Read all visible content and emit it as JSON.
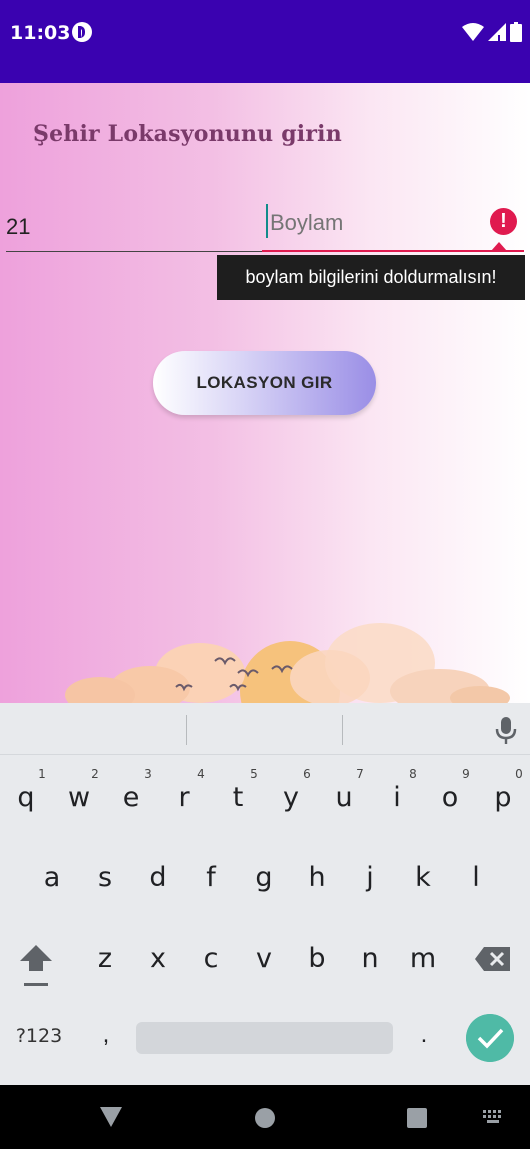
{
  "status_bar": {
    "time": "11:03"
  },
  "app": {
    "title": "Şehir Lokasyonunu girin",
    "latitude_value": "21",
    "longitude_placeholder": "Boylam",
    "error_mark": "!",
    "error_message": "boylam bilgilerini doldurmalısın!",
    "submit_label": "LOKASYON GIR"
  },
  "keyboard": {
    "row1": [
      "q",
      "w",
      "e",
      "r",
      "t",
      "y",
      "u",
      "i",
      "o",
      "p"
    ],
    "row1_hints": [
      "1",
      "2",
      "3",
      "4",
      "5",
      "6",
      "7",
      "8",
      "9",
      "0"
    ],
    "row2": [
      "a",
      "s",
      "d",
      "f",
      "g",
      "h",
      "j",
      "k",
      "l"
    ],
    "row3": [
      "z",
      "x",
      "c",
      "v",
      "b",
      "n",
      "m"
    ],
    "symbols_label": "?123",
    "comma": ",",
    "period": "."
  },
  "colors": {
    "status_bar": "#3a02b0",
    "error": "#e01a4f",
    "enter_key": "#4fbaa6"
  }
}
